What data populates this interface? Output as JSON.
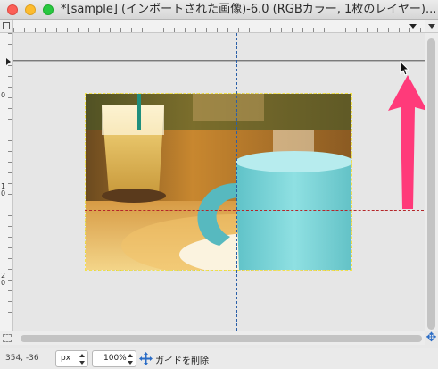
{
  "window": {
    "title": "*[sample] (インポートされた画像)-6.0 (RGBカラー, 1枚のレイヤー)..."
  },
  "rulers": {
    "vertical_tick_labels": [
      "0",
      "1 0",
      "2 0"
    ]
  },
  "canvas": {
    "photo_description_icon": "photo-layer",
    "guide_colors": {
      "vertical": "#2a5fa8",
      "horizontal": "#b5262a",
      "annotation_arrow": "#ff3a7a"
    }
  },
  "statusbar": {
    "pointer_coords": "354, -36",
    "unit": "px",
    "zoom": "100%",
    "status_icon": "move-tool-icon",
    "message": "ガイドを削除"
  }
}
